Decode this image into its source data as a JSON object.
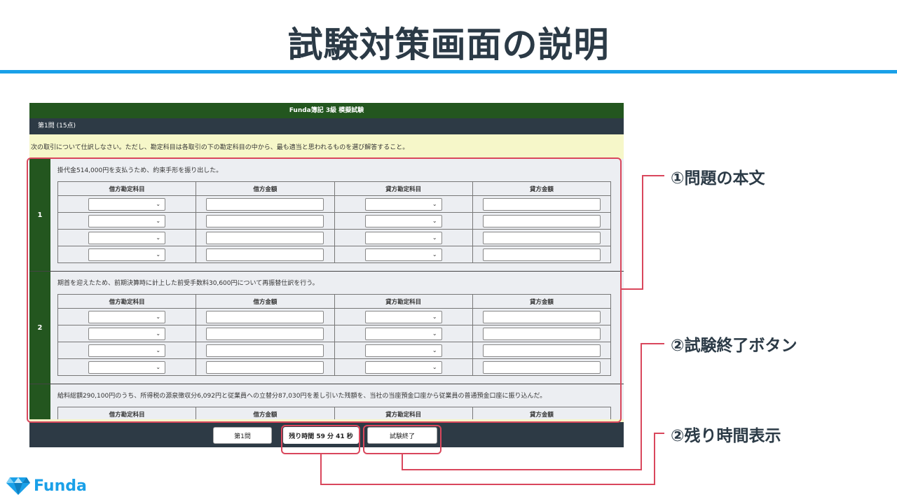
{
  "slide": {
    "title": "試験対策画面の説明",
    "accent_color": "#1aa0e8",
    "highlight_color": "#d9475c"
  },
  "exam": {
    "header": "Funda簿記 3級 模擬試験",
    "question_heading": "第1問 (15点)",
    "instruction": "次の取引について仕訳しなさい。ただし、勘定科目は各取引の下の勘定科目の中から、最も適当と思われるものを選び解答すること。",
    "columns": [
      "借方勘定科目",
      "借方金額",
      "貸方勘定科目",
      "貸方金額"
    ],
    "questions": [
      {
        "number": "1",
        "text": "掛代金514,000円を支払うため、約束手形を振り出した。"
      },
      {
        "number": "2",
        "text": "期首を迎えたため、前期決算時に計上した前受手数料30,600円について再振替仕訳を行う。"
      },
      {
        "number": "",
        "text": "給料総額290,100円のうち、所得税の源泉徴収分6,092円と従業員への立替分87,030円を差し引いた残額を、当社の当座預金口座から従業員の普通預金口座に振り込んだ。"
      }
    ],
    "footer": {
      "question_button": "第1問",
      "timer": "残り時間 59 分 41 秒",
      "end_button": "試験終了"
    }
  },
  "callouts": {
    "body": "①問題の本文",
    "end_button": "②試験終了ボタン",
    "timer": "②残り時間表示"
  },
  "logo": {
    "text": "Funda",
    "icon": "diamond-icon"
  }
}
